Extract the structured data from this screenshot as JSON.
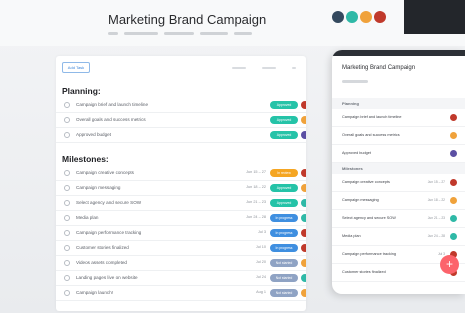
{
  "header": {
    "title": "Marketing Brand Campaign",
    "avatars": [
      "#34495e",
      "#2fb9a7",
      "#f0a23b",
      "#c0392b"
    ]
  },
  "toolbar": {
    "add_task_label": "Add Task"
  },
  "sections": {
    "planning": {
      "title": "Planning:",
      "rows": [
        {
          "name": "Campaign brief and launch timeline",
          "date": "",
          "tag": "Approved",
          "tag_color": "#25c3a8",
          "avatar_color": "#c0392b"
        },
        {
          "name": "Overall goals and success metrics",
          "date": "",
          "tag": "Approved",
          "tag_color": "#25c3a8",
          "avatar_color": "#f0a23b"
        },
        {
          "name": "Approved budget",
          "date": "",
          "tag": "Approved",
          "tag_color": "#25c3a8",
          "avatar_color": "#5b4fa3"
        }
      ]
    },
    "milestones": {
      "title": "Milestones:",
      "rows": [
        {
          "name": "Campaign creative concepts",
          "date": "Jun 15 – 27",
          "tag": "In review",
          "tag_color": "#f5a623",
          "avatar_color": "#c0392b"
        },
        {
          "name": "Campaign messaging",
          "date": "Jun 18 – 22",
          "tag": "Approved",
          "tag_color": "#25c3a8",
          "avatar_color": "#f0a23b"
        },
        {
          "name": "Select agency and secure SOW",
          "date": "Jun 21 – 23",
          "tag": "Approved",
          "tag_color": "#25c3a8",
          "avatar_color": "#2fb9a7"
        },
        {
          "name": "Media plan",
          "date": "Jun 24 – 28",
          "tag": "In progress",
          "tag_color": "#3f8fe0",
          "avatar_color": "#2fb9a7"
        },
        {
          "name": "Campaign performance tracking",
          "date": "Jul 3",
          "tag": "In progress",
          "tag_color": "#3f8fe0",
          "avatar_color": "#c0392b"
        },
        {
          "name": "Customer stories finalized",
          "date": "Jul 10",
          "tag": "In progress",
          "tag_color": "#3f8fe0",
          "avatar_color": "#c0392b"
        },
        {
          "name": "Videos assets completed",
          "date": "Jul 20",
          "tag": "Not started",
          "tag_color": "#8fa3c4",
          "avatar_color": "#f0a23b"
        },
        {
          "name": "Landing pages live on website",
          "date": "Jul 24",
          "tag": "Not started",
          "tag_color": "#8fa3c4",
          "avatar_color": "#2fb9a7"
        },
        {
          "name": "Campaign launch!",
          "date": "Aug 1",
          "tag": "Not started",
          "tag_color": "#8fa3c4",
          "avatar_color": "#f0a23b"
        }
      ]
    }
  },
  "mobile": {
    "title": "Marketing Brand Campaign",
    "planning_label": "Planning",
    "milestones_label": "Milestones",
    "planning_rows": [
      {
        "name": "Campaign brief and launch timeline",
        "date": "",
        "avatar_color": "#c0392b"
      },
      {
        "name": "Overall goals and success metrics",
        "date": "",
        "avatar_color": "#f0a23b"
      },
      {
        "name": "Approved budget",
        "date": "",
        "avatar_color": "#5b4fa3"
      }
    ],
    "milestone_rows": [
      {
        "name": "Campaign creative concepts",
        "date": "Jun 15 – 27",
        "avatar_color": "#c0392b"
      },
      {
        "name": "Campaign messaging",
        "date": "Jun 18 – 22",
        "avatar_color": "#f0a23b"
      },
      {
        "name": "Select agency and secure SOW",
        "date": "Jun 21 – 23",
        "avatar_color": "#2fb9a7"
      },
      {
        "name": "Media plan",
        "date": "Jun 24 – 28",
        "avatar_color": "#2fb9a7"
      },
      {
        "name": "Campaign performance tracking",
        "date": "Jul 3",
        "avatar_color": "#c0392b"
      },
      {
        "name": "Customer stories finalized",
        "date": "",
        "avatar_color": "#c0392b"
      }
    ],
    "fab_label": "+"
  }
}
